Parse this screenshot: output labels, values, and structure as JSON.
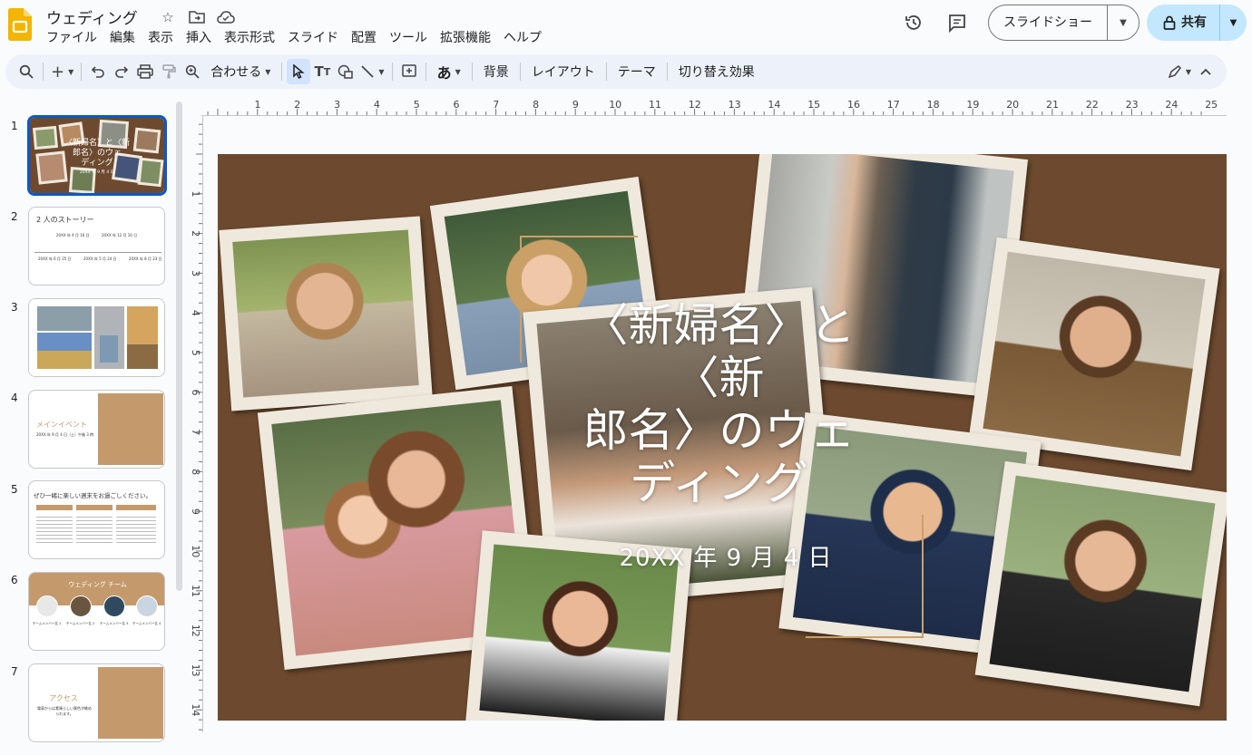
{
  "doc": {
    "title": "ウェディング"
  },
  "menu": [
    "ファイル",
    "編集",
    "表示",
    "挿入",
    "表示形式",
    "スライド",
    "配置",
    "ツール",
    "拡張機能",
    "ヘルプ"
  ],
  "header": {
    "slideshow_label": "スライドショー",
    "share_label": "共有"
  },
  "toolbar": {
    "zoom_label": "合わせる",
    "background_label": "背景",
    "layout_label": "レイアウト",
    "theme_label": "テーマ",
    "transition_label": "切り替え効果",
    "input_tool_label": "あ"
  },
  "slides": [
    {
      "num": "1",
      "title": "〈新婦名〉と〈新郎名〉のウェディング",
      "date": "20XX 年 9 月 4 日"
    },
    {
      "num": "2",
      "title": "2 人のストーリー",
      "items": [
        "20XX 年 4 月 16 日",
        "20XX 年 12 月 10 日",
        "20XX 年 6 月 25 日",
        "20XX 年 5 月 24 日",
        "20XX 年 8 月 23 日"
      ]
    },
    {
      "num": "3"
    },
    {
      "num": "4",
      "title": "メインイベント",
      "body": "20XX 年 9 月 4 日（土）午後 3 時"
    },
    {
      "num": "5",
      "title": "ぜひ一緒に楽しい週末をお過ごしください。"
    },
    {
      "num": "6",
      "title": "ウェディング チーム",
      "members": [
        "チームメンバー名 1",
        "チームメンバー名 2",
        "チームメンバー名 3",
        "チームメンバー名 4"
      ]
    },
    {
      "num": "7",
      "title": "アクセス",
      "body": "電車からは素晴らしい景色が眺められます。"
    }
  ],
  "ruler": {
    "h": [
      "1",
      "2",
      "3",
      "4",
      "5",
      "6",
      "7",
      "8",
      "9",
      "10",
      "11",
      "12",
      "13",
      "14",
      "15",
      "16",
      "17",
      "18",
      "19",
      "20",
      "21",
      "22",
      "23",
      "24",
      "25"
    ],
    "v": [
      "1",
      "2",
      "3",
      "4",
      "5",
      "6",
      "7",
      "8",
      "9",
      "10",
      "11",
      "12",
      "13",
      "14"
    ]
  },
  "colors": {
    "accent_blue": "#0b57d0",
    "share_bg": "#c2e7ff",
    "canvas_brown": "#6d4a2f",
    "gold_line": "#c9a06a",
    "logo_yellow": "#f4b400"
  },
  "icons": [
    "search-icon",
    "plus-icon",
    "undo-icon",
    "redo-icon",
    "print-icon",
    "paint-format-icon",
    "zoom-icon",
    "select-icon",
    "text-box-icon",
    "shape-icon",
    "line-icon",
    "comment-add-icon",
    "history-icon",
    "comment-icon",
    "lock-icon",
    "star-icon",
    "folder-move-icon",
    "cloud-icon",
    "pen-icon",
    "chevron-up-icon"
  ]
}
